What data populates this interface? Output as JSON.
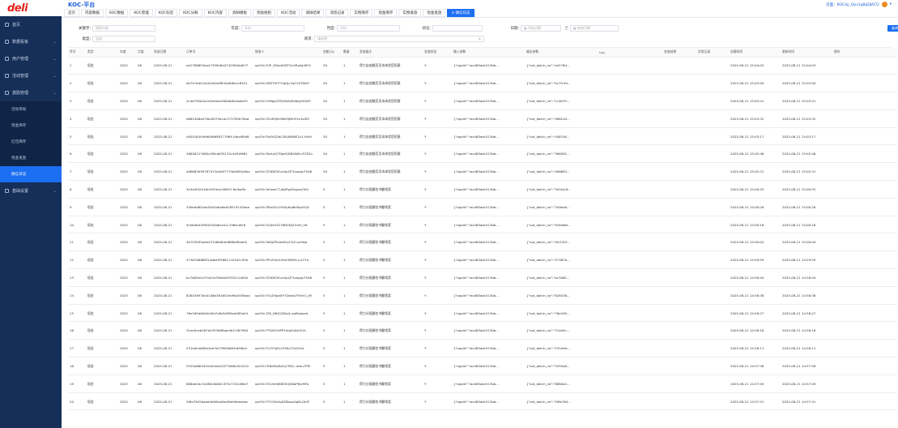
{
  "logo": "deli",
  "app_title": "KOC-平台",
  "header_user": "页面：KOCdy_Opv1g8qDJACO",
  "sidebar": {
    "items": [
      {
        "label": "首页",
        "icon": "home-icon",
        "chev": false
      },
      {
        "label": "数据看板",
        "icon": "chart-icon",
        "chev": true
      },
      {
        "label": "用户管理",
        "icon": "user-icon",
        "chev": true
      },
      {
        "label": "活动管理",
        "icon": "flag-icon",
        "chev": true
      },
      {
        "label": "激励管理",
        "icon": "gift-icon",
        "chev": true
      }
    ],
    "subs": [
      "活动审核",
      "现金库存",
      "红包库存",
      "现金发放",
      "微信日志"
    ],
    "tail": {
      "label": "基础设置",
      "icon": "gear-icon"
    }
  },
  "tabs": [
    "首页",
    "内容数据",
    "KOC数据",
    "KOC管理",
    "KOC标签",
    "KOC分群",
    "KOC内容",
    "调研模板",
    "奖励规则",
    "KOC活动",
    "调研结果",
    "消息记录",
    "实物库存",
    "现金库存",
    "实物发放",
    "现金发放",
    "⊙ 微信日志"
  ],
  "filters": {
    "keyword_label": "关键字:",
    "keyword_ph": "搜索内容",
    "year_label": "年度:",
    "year_ph": "年份",
    "month_label": "月度:",
    "month_ph": "月份",
    "status_label": "状态:",
    "date_label": "日期:",
    "date_start": "开始日期",
    "date_sep": "至",
    "date_end": "结束日期",
    "type_label": "类型:",
    "type_ph": "全部",
    "request_label": "请求:",
    "request_ph": "请选择",
    "search_btn": "查询"
  },
  "columns": [
    "序号",
    "类型",
    "年度",
    "月度",
    "发放日期",
    "订单号",
    "接收人",
    "金额(元)",
    "数量",
    "发放备注",
    "发放状态",
    "输入参数",
    "输出参数",
    "Log",
    "发放结果",
    "异常记录",
    "创建时间",
    "更新时间",
    "操作"
  ],
  "rows": [
    {
      "no": "1",
      "type": "现金",
      "year": "2025",
      "month": "08",
      "date": "2025-08-21",
      "order": "ee2788655ba47399e8d474299d0db77",
      "recv": "opV5n7UP_5Mvdt0DTQcXRwhjr6FQ",
      "amount": "50",
      "qty": "1",
      "note": "得力自由翻页页本体验官招募",
      "status": "Y",
      "input": "{\"appid\":\"wx465abc513bb...",
      "output": "{\"out_batch_no\":\"ee278d...",
      "created": "2025-08-21 15:04:03",
      "updated": "2025-08-21 15:04:03"
    },
    {
      "no": "2",
      "type": "现金",
      "year": "2025",
      "month": "08",
      "date": "2025-08-21",
      "order": "eb7fc3de22b444d2aff834afb6cec8521",
      "recv": "opV5n7WSThFY7rbDp-9p710YMeY",
      "amount": "50",
      "qty": "1",
      "note": "得力自由翻页页本体验官招募",
      "status": "Y",
      "input": "{\"appid\":\"wx465abc513bb...",
      "output": "{\"out_batch_no\":\"bc7fc3d...",
      "created": "2025-08-21 15:03:50",
      "updated": "2025-08-21 15:03:50"
    },
    {
      "no": "3",
      "type": "现金",
      "year": "2025",
      "month": "08",
      "date": "2025-08-21",
      "order": "2c4b790b2a244fe0ab1fb0db8cabab55",
      "recv": "opV5n7c8fgqTZ5JVNA4M4kgVtt5KY",
      "amount": "50",
      "qty": "1",
      "note": "得力自由翻页页本体验官招募",
      "status": "Y",
      "input": "{\"appid\":\"wx465abc513bb...",
      "output": "{\"out_batch_no\":\"2c4b79...",
      "created": "2025-08-21 15:03:41",
      "updated": "2025-08-21 15:03:41"
    },
    {
      "no": "4",
      "type": "现金",
      "year": "2025",
      "month": "08",
      "date": "2025-08-21",
      "order": "d861406ee70b40f79a1ac373785b76ad",
      "recv": "opV5n7Zv4MjhVWeOJBk3Fzc4a3M",
      "amount": "50",
      "qty": "1",
      "note": "得力自由翻页页本体验官招募",
      "status": "Y",
      "input": "{\"appid\":\"wx465abc513bb...",
      "output": "{\"out_batch_no\":\"d86140...",
      "created": "2025-08-21 15:03:32",
      "updated": "2025-08-21 15:03:32"
    },
    {
      "no": "5",
      "type": "现金",
      "year": "2025",
      "month": "08",
      "date": "2025-08-21",
      "order": "c80516449fd64f8698277969 0dcd89d8",
      "recv": "opV5n7fyEhZZdLZ6L8NWE2z1-VdHI",
      "amount": "50",
      "qty": "1",
      "note": "得力自由翻页页本体验官招募",
      "status": "Y",
      "input": "{\"appid\":\"wx465abc513bb...",
      "output": "{\"out_batch_no\":\"c80516...",
      "created": "2025-08-21 15:03:17",
      "updated": "2025-08-21 15:03:17"
    },
    {
      "no": "6",
      "type": "现金",
      "year": "2025",
      "month": "08",
      "date": "2025-08-21",
      "order": "36658127a80c4f6ca835132c4d3bf681",
      "recv": "opV5n7beLaQ7DqeGD6XWfLuFZDCc",
      "amount": "50",
      "qty": "1",
      "note": "得力自由翻页页本体验官招募",
      "status": "Y",
      "input": "{\"appid\":\"wx465abc513bb...",
      "output": "{\"out_batch_no\":\"366581...",
      "created": "2025-08-21 15:02:46",
      "updated": "2025-08-21 15:02:46"
    },
    {
      "no": "7",
      "type": "现金",
      "year": "2025",
      "month": "08",
      "date": "2025-08-21",
      "order": "d08683099787413a0e87779b0085e8ae",
      "recv": "opV5n7Z4DK2EuuXpQT3vappLF5A8",
      "amount": "50",
      "qty": "1",
      "note": "得力自由翻页页本体验官招募",
      "status": "Y",
      "input": "{\"appid\":\"wx465abc513bb...",
      "output": "{\"out_batch_no\":\"d08683...",
      "created": "2025-08-21 15:02:31",
      "updated": "2025-08-21 15:02:31"
    },
    {
      "no": "8",
      "type": "现金",
      "year": "2025",
      "month": "08",
      "date": "2025-08-21",
      "order": "3e3e4f42d16c45f1b4c46922 6cfbaffa",
      "recv": "opV5n7ehweCT-dtpPgnDqyeaOh0",
      "amount": "5",
      "qty": "1",
      "note": "得力分段翻包书翻领奖",
      "status": "Y",
      "input": "{\"appid\":\"wx465abc513bb...",
      "output": "{\"out_batch_no\":\"3e3e44f...",
      "created": "2025-08-21 15:00:55",
      "updated": "2025-08-21 15:00:55"
    },
    {
      "no": "9",
      "type": "现金",
      "year": "2025",
      "month": "08",
      "date": "2025-08-21",
      "order": "349edd80cde54e5aba6ed28519145aba",
      "recv": "opV5n7fDeZo12H5IpKqi6cBpx5Q4",
      "amount": "5",
      "qty": "1",
      "note": "得力分段翻包书翻领奖",
      "status": "Y",
      "input": "{\"appid\":\"wx465abc513bb...",
      "output": "{\"out_batch_no\":\"349edd...",
      "created": "2025-08-21 15:00:26",
      "updated": "2025-08-21 15:00:26"
    },
    {
      "no": "10",
      "type": "现金",
      "year": "2025",
      "month": "08",
      "date": "2025-08-21",
      "order": "9cfab8dc49f0425eb6ce4cc7d6ecdfc6",
      "recv": "opV5n7uVJerOG76BCKqTme5_h8",
      "amount": "5",
      "qty": "1",
      "note": "得力分段翻包书翻领奖",
      "status": "Y",
      "input": "{\"appid\":\"wx465abc513bb...",
      "output": "{\"out_batch_no\":\"9cfab8d...",
      "created": "2025-08-21 15:00:16",
      "updated": "2025-08-21 15:00:16"
    },
    {
      "no": "11",
      "type": "现金",
      "year": "2025",
      "month": "08",
      "date": "2025-08-21",
      "order": "4fc532f05aeb43708b0b0d688af8ade5",
      "recv": "opV5n7dKiJZRsAv8VyCGZ-sxHkJo",
      "amount": "5",
      "qty": "1",
      "note": "得力分段翻包书翻领奖",
      "status": "Y",
      "input": "{\"appid\":\"wx465abc513bb...",
      "output": "{\"out_batch_no\":\"4fc532f...",
      "created": "2025-08-21 15:00:04",
      "updated": "2025-08-21 15:00:04"
    },
    {
      "no": "12",
      "type": "现金",
      "year": "2025",
      "month": "08",
      "date": "2025-08-21",
      "order": "47367b6668f14dba9f28617ce3d1c93b",
      "recv": "opV5n7PcVGxhUHnt38M3cy-b77o",
      "amount": "5",
      "qty": "1",
      "note": "得力分段翻包书翻领奖",
      "status": "Y",
      "input": "{\"appid\":\"wx465abc513bb...",
      "output": "{\"out_batch_no\":\"47367b...",
      "created": "2025-08-21 14:59:59",
      "updated": "2025-08-21 14:59:59"
    },
    {
      "no": "13",
      "type": "现金",
      "year": "2025",
      "month": "08",
      "date": "2025-08-21",
      "order": "bc7b82b2a75441e39b4bf2f352c1d03b",
      "recv": "opV5n7Z4DK2EuuXpQT3vappLF5A8",
      "amount": "5",
      "qty": "1",
      "note": "得力分段翻包书翻领奖",
      "status": "Y",
      "input": "{\"appid\":\"wx465abc513bb...",
      "output": "{\"out_batch_no\":\"bc7b82...",
      "created": "2025-08-21 14:58:44",
      "updated": "2025-08-21 14:58:44"
    },
    {
      "no": "14",
      "type": "现金",
      "year": "2025",
      "month": "08",
      "date": "2025-08-21",
      "order": "82643897bd4146e381652ed9bd358eaa",
      "recv": "opV5n7OyZHpdXY7QskeLFHVnO_jM",
      "amount": "5",
      "qty": "1",
      "note": "得力分段翻包书翻领奖",
      "status": "Y",
      "input": "{\"appid\":\"wx465abc513bb...",
      "output": "{\"out_batch_no\":\"826438...",
      "created": "2025-08-21 14:58:38",
      "updated": "2025-08-21 14:58:38"
    },
    {
      "no": "15",
      "type": "现金",
      "year": "2025",
      "month": "08",
      "date": "2025-08-21",
      "order": "76e165d60efe40d7a8dfc899ee085a04",
      "recv": "opV5n7ZK_8NGC8SqlL-xqffzqweA",
      "amount": "5",
      "qty": "1",
      "note": "得力分段翻包书翻领奖",
      "status": "Y",
      "input": "{\"appid\":\"wx465abc513bb...",
      "output": "{\"out_batch_no\":\"76e165...",
      "created": "2025-08-21 14:58:27",
      "updated": "2025-08-21 14:58:27"
    },
    {
      "no": "16",
      "type": "现金",
      "year": "2025",
      "month": "08",
      "date": "2025-08-21",
      "order": "31ee9ceb267b4353b8fbae4b21f67984",
      "recv": "opV5n7T92IEOtPP3ntpfn4bUCVc",
      "amount": "5",
      "qty": "1",
      "note": "得力分段翻包书翻领奖",
      "status": "Y",
      "input": "{\"appid\":\"wx465abc513bb...",
      "output": "{\"out_batch_no\":\"31ee9c...",
      "created": "2025-08-21 14:58:16",
      "updated": "2025-08-21 14:58:16"
    },
    {
      "no": "17",
      "type": "现金",
      "year": "2025",
      "month": "08",
      "date": "2025-08-21",
      "order": "531ebfcb60fe4ee3e37f626d63de96a4",
      "recv": "opV5n7U-FiYg5LLF9Kc1TuS2nfc",
      "amount": "5",
      "qty": "1",
      "note": "得力分段翻包书翻领奖",
      "status": "Y",
      "input": "{\"appid\":\"wx465abc513bb...",
      "output": "{\"out_batch_no\":\"531ebfc...",
      "created": "2025-08-21 14:58:11",
      "updated": "2025-08-21 14:58:11"
    },
    {
      "no": "18",
      "type": "现金",
      "year": "2025",
      "month": "08",
      "date": "2025-08-21",
      "order": "5555a86f442e4e5eae2977d68c824222",
      "recv": "opV5n7XBaPpWzEyCP62--wwu7PM",
      "amount": "5",
      "qty": "1",
      "note": "得力分段翻包书翻领奖",
      "status": "Y",
      "input": "{\"appid\":\"wx465abc513bb...",
      "output": "{\"out_batch_no\":\"5555a8...",
      "created": "2025-08-21 14:57:58",
      "updated": "2025-08-21 14:57:58"
    },
    {
      "no": "19",
      "type": "现金",
      "year": "2025",
      "month": "08",
      "date": "2025-08-21",
      "order": "686da2bc3cd84c8a8e13f7a7152c66d7",
      "recv": "opV5n7X1XmWt8E5QD8aPKjvMFo",
      "amount": "5",
      "qty": "1",
      "note": "得力分段翻包书翻领奖",
      "status": "Y",
      "input": "{\"appid\":\"wx465abc513bb...",
      "output": "{\"out_batch_no\":\"686da2...",
      "created": "2025-08-21 14:57:49",
      "updated": "2025-08-21 14:57:49"
    },
    {
      "no": "20",
      "type": "现金",
      "year": "2025",
      "month": "08",
      "date": "2025-08-21",
      "order": "5f8e7642baad4e60ba0bc69a9deeaeac",
      "recv": "opV5n7TCGSsHgSZ8wpx0g8LQt4Y",
      "amount": "5",
      "qty": "1",
      "note": "得力分段翻包书翻领奖",
      "status": "Y",
      "input": "{\"appid\":\"wx465abc513bb...",
      "output": "{\"out_batch_no\":\"5f8e764...",
      "created": "2025-08-21 14:57:41",
      "updated": "2025-08-21 14:57:41"
    }
  ]
}
